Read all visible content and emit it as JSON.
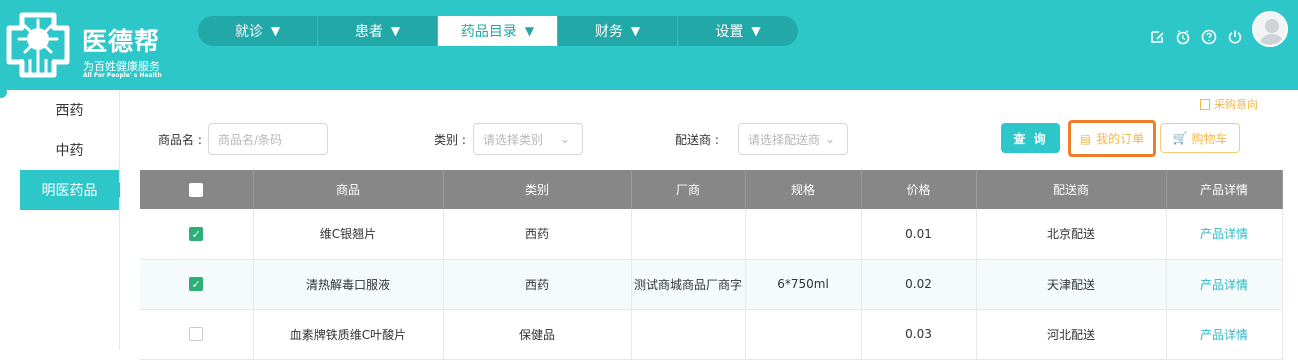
{
  "header": {
    "brand": "医德帮",
    "tagline": "为百姓健康服务",
    "tagline_en": "All For People' s Health",
    "nav": [
      {
        "label": "就诊",
        "active": false
      },
      {
        "label": "患者",
        "active": false
      },
      {
        "label": "药品目录",
        "active": true
      },
      {
        "label": "财务",
        "active": false
      },
      {
        "label": "设置",
        "active": false
      }
    ],
    "icons": [
      "edit-icon",
      "alarm-clock-icon",
      "help-icon",
      "power-icon"
    ],
    "avatar": "user-avatar"
  },
  "sidebar": {
    "items": [
      {
        "label": "西药",
        "active": false
      },
      {
        "label": "中药",
        "active": false
      },
      {
        "label": "明医药品",
        "active": true
      }
    ]
  },
  "toolbar": {
    "purchase_intent": "采购意向",
    "product_label": "商品名 :",
    "product_placeholder": "商品名/条码",
    "category_label": "类别 :",
    "category_placeholder": "请选择类别",
    "distributor_label": "配送商 :",
    "distributor_placeholder": "请选择配送商",
    "query": "查 询",
    "my_orders": "我的订单",
    "cart": "购物车"
  },
  "table": {
    "headers": [
      "",
      "商品",
      "类别",
      "厂商",
      "规格",
      "价格",
      "配送商",
      "产品详情"
    ],
    "rows": [
      {
        "checked": true,
        "product": "维C银翘片",
        "category": "西药",
        "manufacturer": "",
        "spec": "",
        "price": "0.01",
        "distributor": "北京配送",
        "detail": "产品详情"
      },
      {
        "checked": true,
        "product": "清热解毒口服液",
        "category": "西药",
        "manufacturer": "测试商城商品厂商字",
        "spec": "6*750ml",
        "price": "0.02",
        "distributor": "天津配送",
        "detail": "产品详情"
      },
      {
        "checked": false,
        "product": "血素牌铁质维C叶酸片",
        "category": "保健品",
        "manufacturer": "",
        "spec": "",
        "price": "0.03",
        "distributor": "河北配送",
        "detail": "产品详情"
      }
    ]
  },
  "colors": {
    "primary": "#2ec7c9",
    "header_dark": "#22a9a7",
    "table_header": "#878787",
    "orange": "#ef7e2b",
    "gold": "#f2b84b",
    "link": "#2eb8c5",
    "checked": "#2eae78"
  }
}
